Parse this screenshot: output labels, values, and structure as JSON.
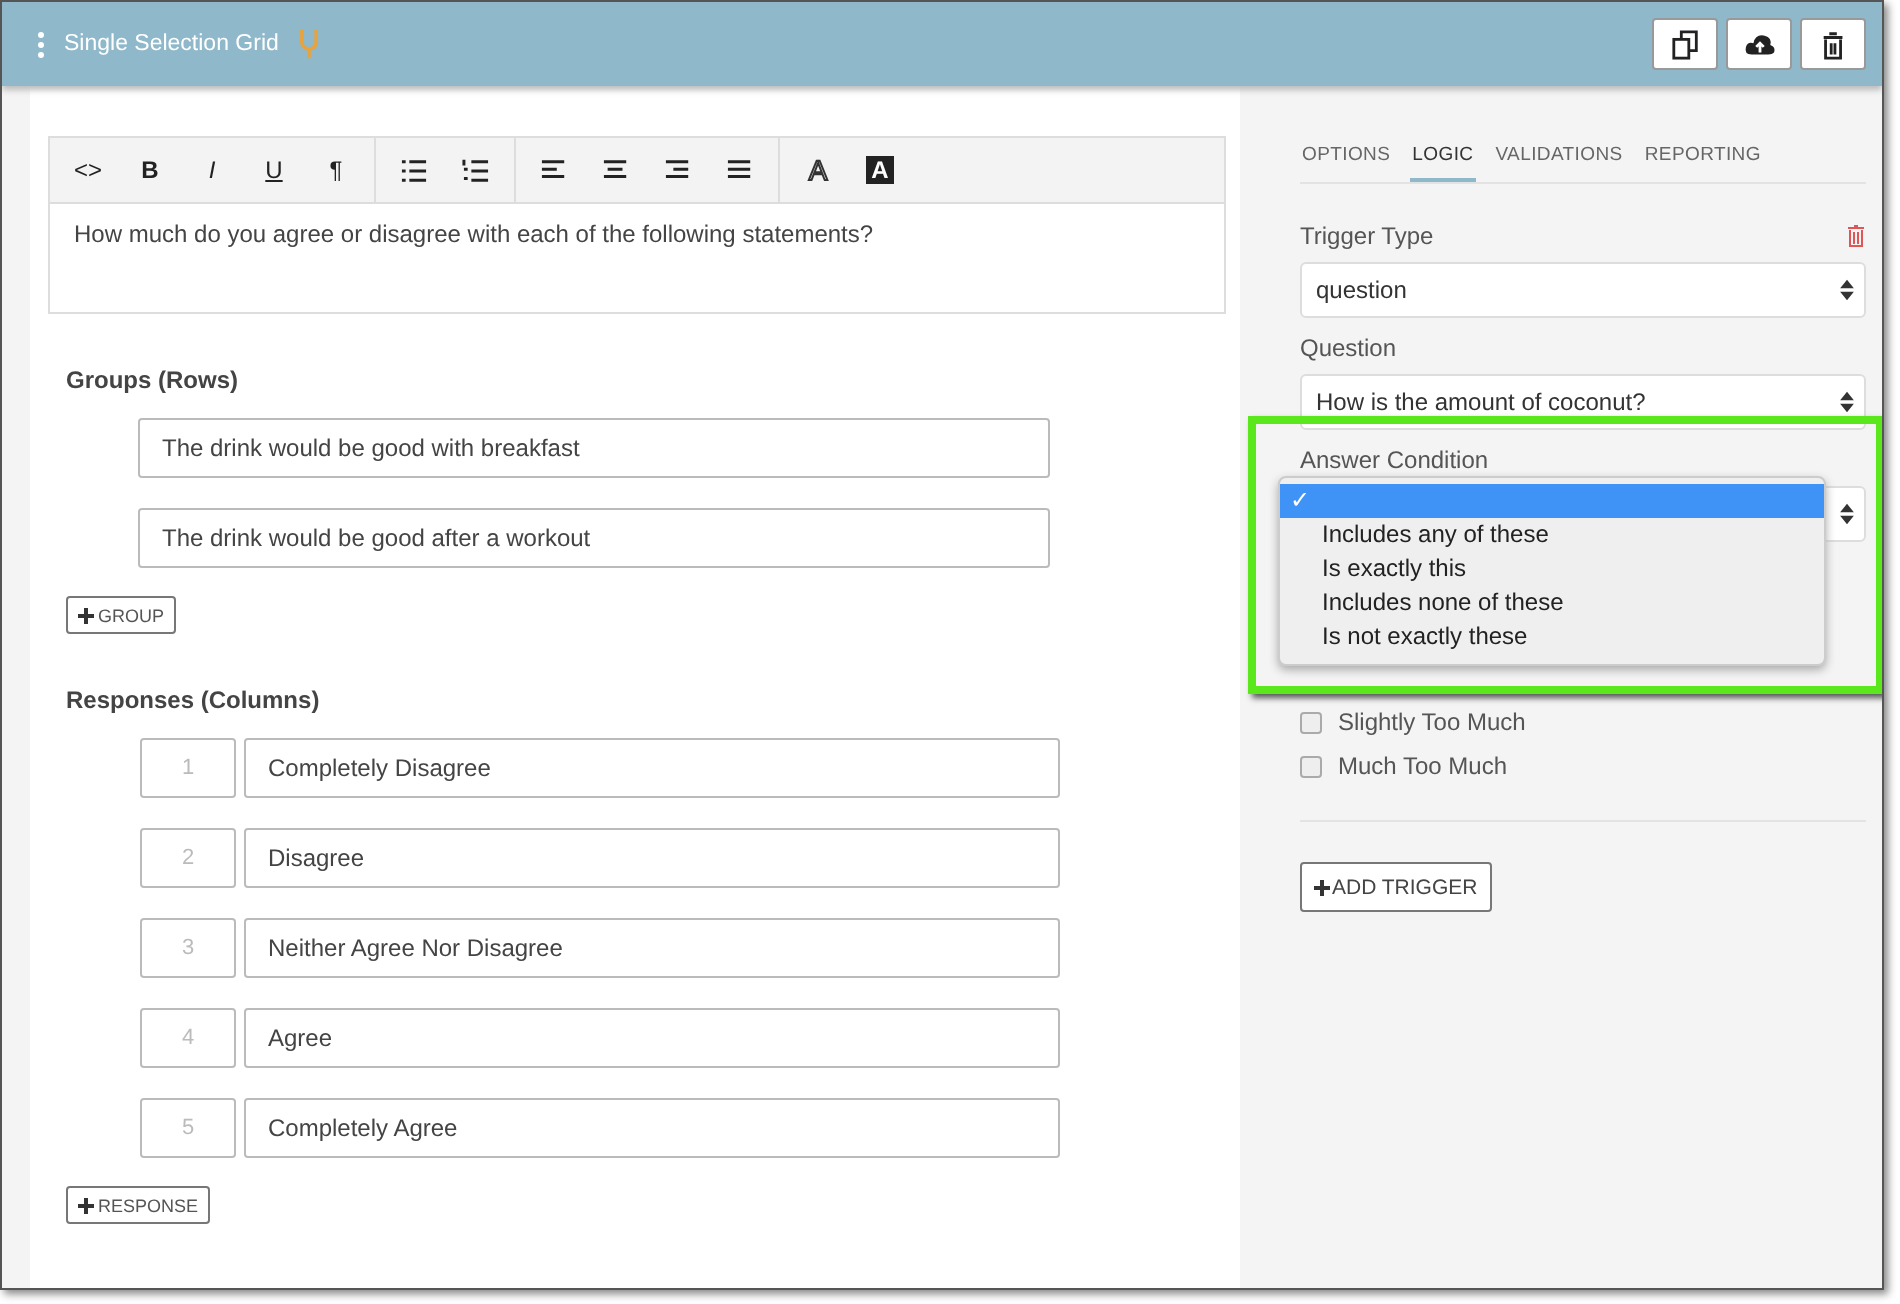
{
  "header": {
    "title": "Single Selection Grid",
    "actions": [
      {
        "kind": "copy"
      },
      {
        "kind": "upload"
      },
      {
        "kind": "delete"
      }
    ]
  },
  "editor": {
    "toolbar": [
      [
        {
          "kind": "code",
          "label": "<>"
        },
        {
          "kind": "bold",
          "label": "B"
        },
        {
          "kind": "italic",
          "label": "I"
        },
        {
          "kind": "underline",
          "label": "U"
        },
        {
          "kind": "paragraph",
          "label": "¶"
        }
      ],
      [
        {
          "kind": "bullets"
        },
        {
          "kind": "numbers"
        }
      ],
      [
        {
          "kind": "align-left"
        },
        {
          "kind": "align-center"
        },
        {
          "kind": "align-right"
        },
        {
          "kind": "justify"
        }
      ],
      [
        {
          "kind": "font-color",
          "label": "A"
        },
        {
          "kind": "highlight",
          "label": "A"
        }
      ]
    ],
    "text": "How much do you agree or disagree with each of the following statements?"
  },
  "groups": {
    "title": "Groups (Rows)",
    "items": [
      "The drink would be good with breakfast",
      "The drink would be good after a workout"
    ],
    "add_button": "GROUP"
  },
  "responses": {
    "title": "Responses (Columns)",
    "items": [
      {
        "number": "1",
        "label": "Completely Disagree"
      },
      {
        "number": "2",
        "label": "Disagree"
      },
      {
        "number": "3",
        "label": "Neither Agree Nor Disagree"
      },
      {
        "number": "4",
        "label": "Agree"
      },
      {
        "number": "5",
        "label": "Completely Agree"
      }
    ],
    "add_button": "RESPONSE"
  },
  "tabs": [
    {
      "label": "OPTIONS",
      "selected": false
    },
    {
      "label": "LOGIC",
      "selected": true
    },
    {
      "label": "VALIDATIONS",
      "selected": false
    },
    {
      "label": "REPORTING",
      "selected": false
    }
  ],
  "logic": {
    "trigger_type": {
      "label": "Trigger Type",
      "value": "question"
    },
    "question": {
      "label": "Question",
      "value": "How is the amount of coconut?"
    },
    "answer_condition": {
      "label": "Answer Condition",
      "options": [
        {
          "label": "✓",
          "selected": true
        },
        {
          "label": "Includes any of these",
          "selected": false
        },
        {
          "label": "Is exactly this",
          "selected": false
        },
        {
          "label": "Includes none of these",
          "selected": false
        },
        {
          "label": "Is not exactly these",
          "selected": false
        }
      ]
    },
    "answers": [
      {
        "label": "Slightly Too Much",
        "checked": false
      },
      {
        "label": "Much Too Much",
        "checked": false
      }
    ],
    "add_button": "ADD TRIGGER"
  }
}
